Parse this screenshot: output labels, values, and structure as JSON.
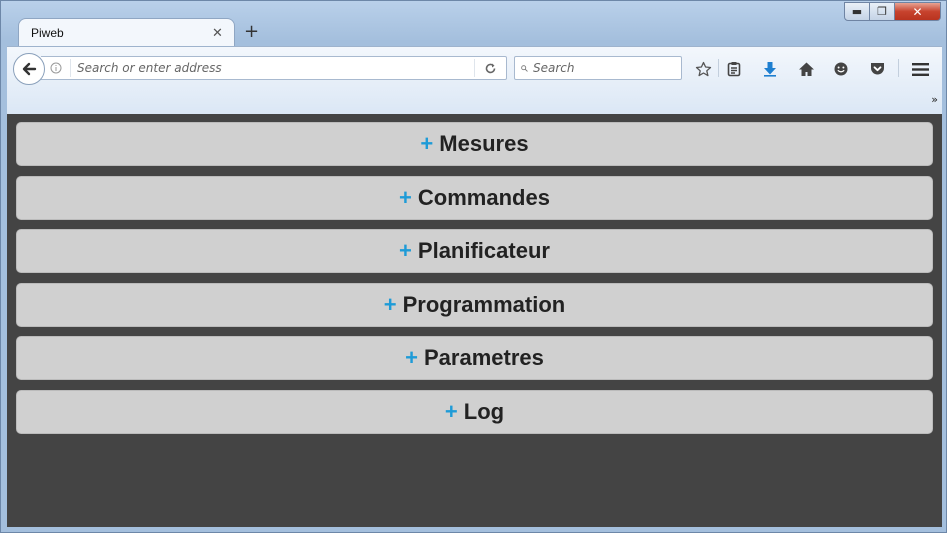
{
  "browser": {
    "tab": {
      "title": "Piweb",
      "close_glyph": "✕"
    },
    "new_tab_glyph": "+",
    "url_placeholder": "Search or enter address",
    "search_placeholder": "Search",
    "overflow_glyph": "»",
    "window_controls": {
      "min": "▬",
      "max": "❐",
      "close": "✕"
    }
  },
  "accordion": {
    "plus_glyph": "+",
    "plus_color": "#1e9bd7",
    "items": [
      {
        "label": "Mesures"
      },
      {
        "label": "Commandes"
      },
      {
        "label": "Planificateur"
      },
      {
        "label": "Programmation"
      },
      {
        "label": "Parametres"
      },
      {
        "label": "Log"
      }
    ]
  }
}
